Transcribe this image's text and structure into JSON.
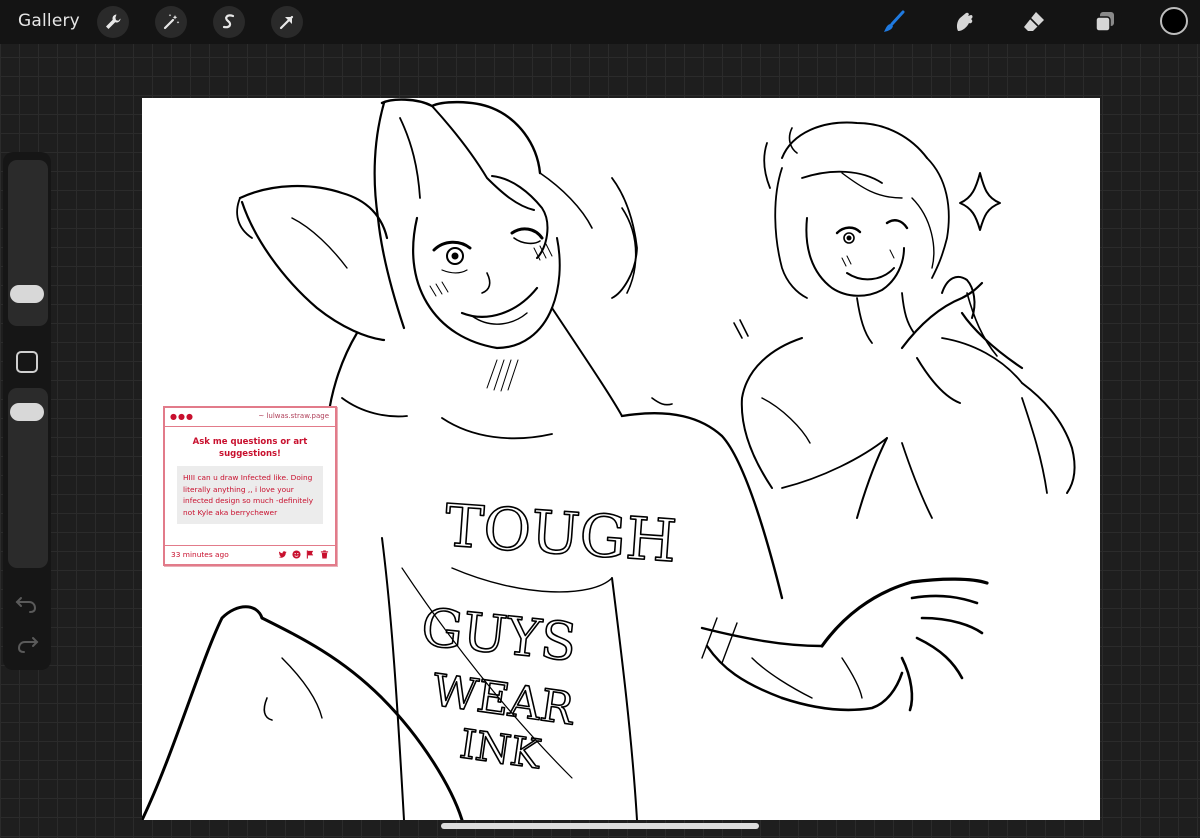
{
  "toolbar": {
    "gallery_label": "Gallery",
    "left_tools": [
      "wrench-icon",
      "magic-wand-icon",
      "selection-icon",
      "transform-arrow-icon"
    ],
    "right_tools": [
      "brush-icon",
      "smudge-icon",
      "eraser-icon",
      "layers-icon"
    ],
    "active_tool": "brush-icon",
    "current_color": "#000000",
    "accent_color": "#1f7ae0"
  },
  "sidebar": {
    "controls": [
      "brush-size-slider",
      "modify-button",
      "opacity-slider",
      "undo-icon",
      "redo-icon"
    ]
  },
  "ask_card": {
    "site": "~ lulwas.straw.page",
    "title": "Ask me questions or art suggestions!",
    "message": "HIII can u draw Infected like. Doing literally anything ,, i love your infected design so much -definitely not Kyle aka berrychewer",
    "timestamp": "33 minutes ago",
    "actions": [
      "twitter-icon",
      "emoji-icon",
      "flag-icon",
      "trash-icon"
    ],
    "accent_color": "#c8102e"
  },
  "shirt_text": {
    "line1": "TOUGH",
    "line2": "GUYS",
    "line3": "WEAR",
    "line4": "INK"
  }
}
